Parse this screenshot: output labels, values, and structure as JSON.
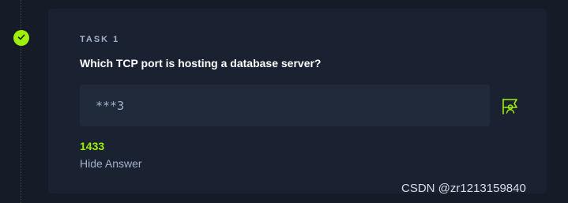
{
  "task": {
    "label": "TASK 1",
    "question": "Which TCP port is hosting a database server?",
    "answer_display": "***3",
    "revealed_answer": "1433",
    "hide_answer_label": "Hide Answer",
    "status": "completed"
  },
  "icons": {
    "status": "check-icon",
    "submit": "flag-icon"
  },
  "colors": {
    "accent": "#9fef00",
    "background": "#151b27",
    "card": "#1a2231",
    "input": "#202a3a",
    "muted_text": "#a4b1cd"
  },
  "watermark": "CSDN @zr1213159840"
}
